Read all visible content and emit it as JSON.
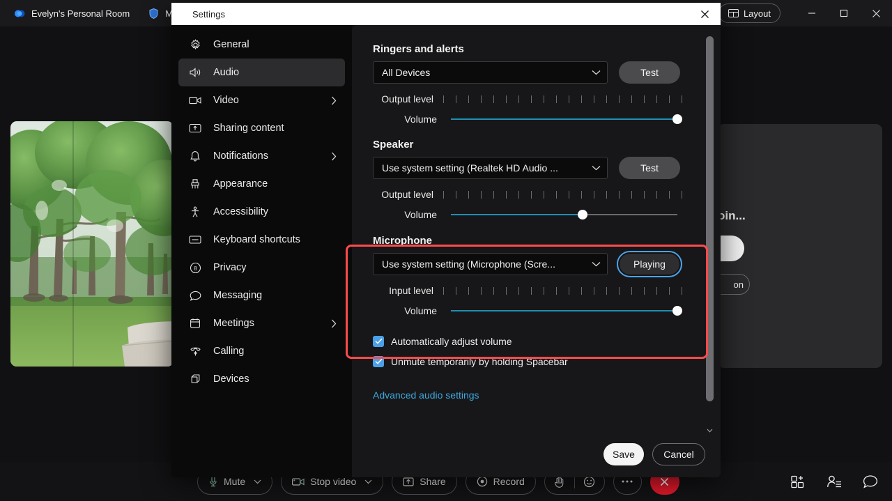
{
  "app": {
    "tabs": [
      {
        "label": "Evelyn's Personal Room",
        "icon": "zoom-logo-icon"
      },
      {
        "label": "Meeting",
        "icon": "shield-icon"
      }
    ],
    "titlebar": {
      "network_icon": "network-quality-icon",
      "layout_label": "Layout",
      "layout_icon": "layout-grid-icon",
      "minimize_icon": "minimize-icon",
      "maximize_icon": "maximize-icon",
      "close_icon": "close-icon"
    },
    "side_panel": {
      "text": "oin...",
      "secondary_label": "on"
    },
    "toolbar": {
      "items": [
        {
          "label": "Mute",
          "icon": "microphone-icon",
          "has_caret": true
        },
        {
          "label": "Stop video",
          "icon": "video-camera-icon",
          "has_caret": true
        },
        {
          "label": "Share",
          "icon": "share-screen-icon",
          "has_caret": false
        },
        {
          "label": "Record",
          "icon": "record-icon",
          "has_caret": false
        }
      ],
      "reactions_icon": "raise-hand-icon",
      "emoji_icon": "smiley-icon",
      "more_icon": "more-ellipsis-icon",
      "leave_icon": "leave-call-x-icon",
      "right_icons": [
        {
          "name": "apps-add-icon"
        },
        {
          "name": "participants-icon"
        },
        {
          "name": "chat-bubble-icon"
        }
      ]
    }
  },
  "dialog": {
    "title": "Settings",
    "close_icon": "close-icon",
    "nav": [
      {
        "label": "General",
        "icon": "gear-icon",
        "chevron": false,
        "active": false
      },
      {
        "label": "Audio",
        "icon": "speaker-icon",
        "chevron": false,
        "active": true
      },
      {
        "label": "Video",
        "icon": "video-camera-icon",
        "chevron": true,
        "active": false
      },
      {
        "label": "Sharing content",
        "icon": "share-content-icon",
        "chevron": false,
        "active": false
      },
      {
        "label": "Notifications",
        "icon": "bell-icon",
        "chevron": true,
        "active": false
      },
      {
        "label": "Appearance",
        "icon": "appearance-icon",
        "chevron": false,
        "active": false
      },
      {
        "label": "Accessibility",
        "icon": "accessibility-icon",
        "chevron": false,
        "active": false
      },
      {
        "label": "Keyboard shortcuts",
        "icon": "keyboard-icon",
        "chevron": false,
        "active": false
      },
      {
        "label": "Privacy",
        "icon": "privacy-shield-icon",
        "chevron": false,
        "active": false
      },
      {
        "label": "Messaging",
        "icon": "message-bubble-icon",
        "chevron": false,
        "active": false
      },
      {
        "label": "Meetings",
        "icon": "calendar-icon",
        "chevron": true,
        "active": false
      },
      {
        "label": "Calling",
        "icon": "phone-icon",
        "chevron": false,
        "active": false
      },
      {
        "label": "Devices",
        "icon": "devices-icon",
        "chevron": false,
        "active": false
      }
    ],
    "audio": {
      "ringers": {
        "title": "Ringers and alerts",
        "device_value": "All Devices",
        "test_label": "Test",
        "output_level_label": "Output level",
        "volume_label": "Volume",
        "volume_percent": 100
      },
      "speaker": {
        "title": "Speaker",
        "device_value": "Use system setting (Realtek HD Audio ...",
        "test_label": "Test",
        "output_level_label": "Output level",
        "volume_label": "Volume",
        "volume_percent": 58
      },
      "microphone": {
        "title": "Microphone",
        "device_value": "Use system setting (Microphone (Scre...",
        "test_label": "Playing",
        "input_level_label": "Input level",
        "volume_label": "Volume",
        "volume_percent": 100,
        "highlight_color": "#ff4b4b"
      },
      "checkboxes": [
        {
          "label": "Automatically adjust volume",
          "checked": true
        },
        {
          "label": "Unmute temporarily by holding Spacebar",
          "checked": true
        }
      ],
      "advanced_link": "Advanced audio settings"
    },
    "footer": {
      "save_label": "Save",
      "cancel_label": "Cancel"
    }
  },
  "colors": {
    "accent_blue": "#1f8fb5",
    "focus_blue": "#4aa3e8",
    "highlight_red": "#ff4b4b",
    "leave_red": "#e8192c",
    "link_blue": "#3ea7dc"
  }
}
